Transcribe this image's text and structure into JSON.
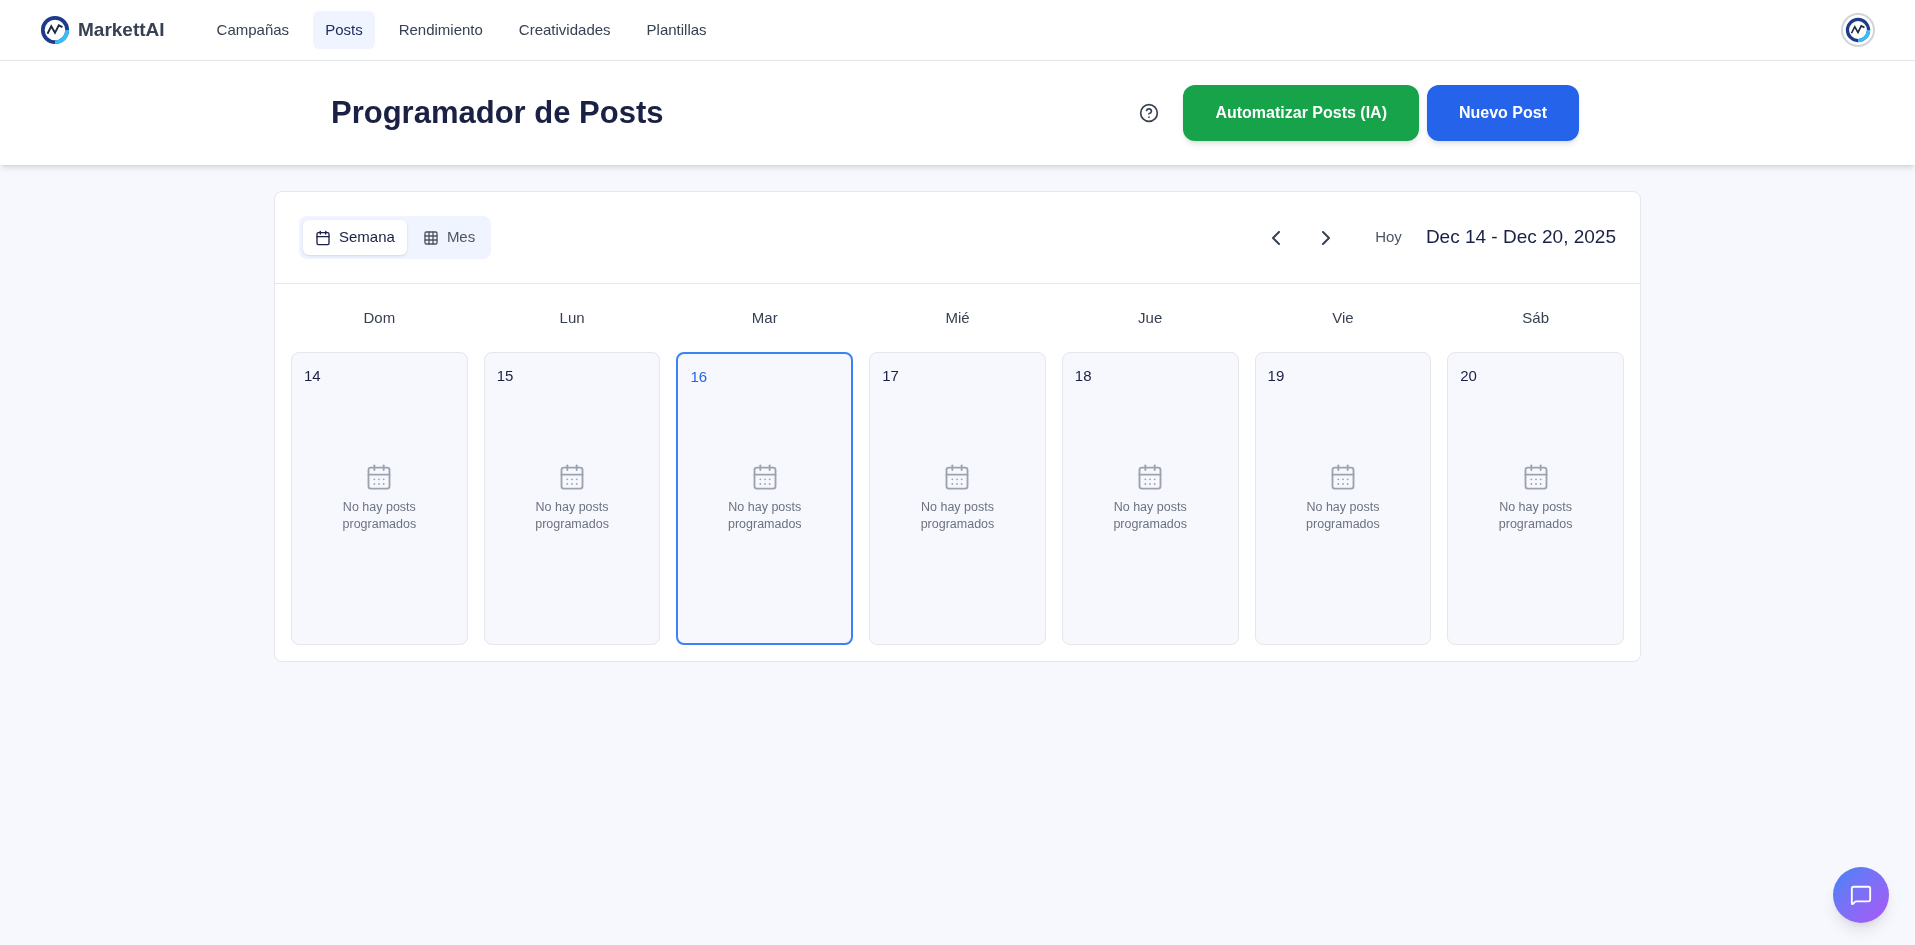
{
  "brand": {
    "name": "MarkettAI"
  },
  "nav": [
    {
      "label": "Campañas",
      "selected": false
    },
    {
      "label": "Posts",
      "selected": true
    },
    {
      "label": "Rendimiento",
      "selected": false
    },
    {
      "label": "Creatividades",
      "selected": false
    },
    {
      "label": "Plantillas",
      "selected": false
    }
  ],
  "header": {
    "title": "Programador de Posts",
    "buttons": [
      {
        "label": "Automatizar Posts (IA)",
        "kind": "secondary"
      },
      {
        "label": "Nuevo Post",
        "kind": "primary"
      }
    ]
  },
  "calendar": {
    "views": [
      {
        "label": "Semana",
        "kind": "week",
        "selected": true
      },
      {
        "label": "Mes",
        "kind": "month",
        "selected": false
      }
    ],
    "today_label": "Hoy",
    "range": "Dec 14 - Dec 20, 2025",
    "days": [
      {
        "weekday": "Dom",
        "date": "14",
        "selected": false,
        "empty_text": "No hay posts programados"
      },
      {
        "weekday": "Lun",
        "date": "15",
        "selected": false,
        "empty_text": "No hay posts programados"
      },
      {
        "weekday": "Mar",
        "date": "16",
        "selected": true,
        "empty_text": "No hay posts programados"
      },
      {
        "weekday": "Mié",
        "date": "17",
        "selected": false,
        "empty_text": "No hay posts programados"
      },
      {
        "weekday": "Jue",
        "date": "18",
        "selected": false,
        "empty_text": "No hay posts programados"
      },
      {
        "weekday": "Vie",
        "date": "19",
        "selected": false,
        "empty_text": "No hay posts programados"
      },
      {
        "weekday": "Sáb",
        "date": "20",
        "selected": false,
        "empty_text": "No hay posts programados"
      }
    ]
  }
}
